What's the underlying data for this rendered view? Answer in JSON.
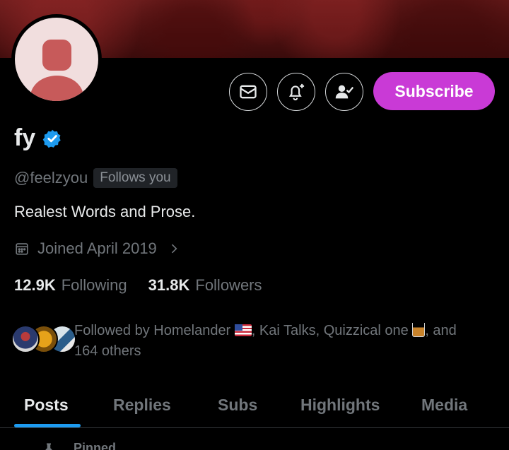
{
  "profile": {
    "display_name": "fy",
    "handle": "@feelzyou",
    "follows_you_badge": "Follows you",
    "bio": "Realest Words and Prose.",
    "joined": "Joined April 2019",
    "verified": true
  },
  "actions": {
    "subscribe_label": "Subscribe",
    "message_icon": "envelope-icon",
    "notify_icon": "bell-plus-icon",
    "follow_icon": "person-check-icon"
  },
  "stats": {
    "following_count": "12.9K",
    "following_label": "Following",
    "followers_count": "31.8K",
    "followers_label": "Followers"
  },
  "followed_by": {
    "prefix": "Followed by Homelander",
    "part2": ", Kai Talks, Quizzical one",
    "suffix": ", and",
    "line2": "164 others"
  },
  "tabs": [
    {
      "label": "Posts",
      "active": true
    },
    {
      "label": "Replies",
      "active": false
    },
    {
      "label": "Subs",
      "active": false
    },
    {
      "label": "Highlights",
      "active": false
    },
    {
      "label": "Media",
      "active": false
    }
  ],
  "pinned_label": "Pinned",
  "colors": {
    "accent": "#1d9bf0",
    "subscribe": "#c93ad6",
    "verified": "#1d9bf0"
  }
}
